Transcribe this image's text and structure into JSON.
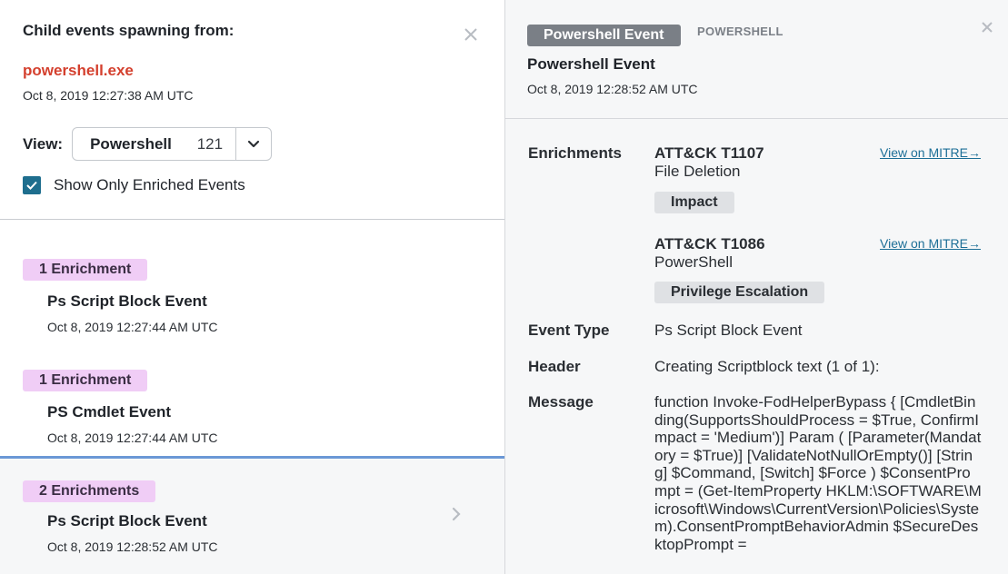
{
  "left_panel": {
    "title": "Child events spawning from:",
    "process": "powershell.exe",
    "timestamp": "Oct 8, 2019 12:27:38 AM UTC",
    "view": {
      "label": "View:",
      "selected": "Powershell",
      "count": "121"
    },
    "checkbox": {
      "label": "Show Only Enriched Events",
      "checked": true
    },
    "events": [
      {
        "badge": "1 Enrichment",
        "name": "Ps Script Block Event",
        "timestamp": "Oct 8, 2019 12:27:44 AM UTC"
      },
      {
        "badge": "1 Enrichment",
        "name": "PS Cmdlet Event",
        "timestamp": "Oct 8, 2019 12:27:44 AM UTC"
      },
      {
        "badge": "2 Enrichments",
        "name": "Ps Script Block Event",
        "timestamp": "Oct 8, 2019 12:28:52 AM UTC"
      }
    ]
  },
  "right_panel": {
    "tag": "Powershell Event",
    "source": "POWERSHELL",
    "title": "Powershell Event",
    "timestamp": "Oct 8, 2019 12:28:52 AM UTC",
    "enrichments_label": "Enrichments",
    "enrichments": [
      {
        "id": "ATT&CK T1107",
        "name": "File Deletion",
        "tactic": "Impact",
        "link": "View on MITRE→"
      },
      {
        "id": "ATT&CK T1086",
        "name": "PowerShell",
        "tactic": "Privilege Escalation",
        "link": "View on MITRE→"
      }
    ],
    "event_type_label": "Event Type",
    "event_type": "Ps Script Block Event",
    "header_label": "Header",
    "header": "Creating Scriptblock text (1 of 1):",
    "message_label": "Message",
    "message": "function Invoke-FodHelperBypass { [CmdletBinding(SupportsShouldProcess = $True, ConfirmImpact = 'Medium')] Param ( [Parameter(Mandatory = $True)] [ValidateNotNullOrEmpty()] [String] $Command, [Switch] $Force ) $ConsentPrompt = (Get-ItemProperty HKLM:\\SOFTWARE\\Microsoft\\Windows\\CurrentVersion\\Policies\\System).ConsentPromptBehaviorAdmin $SecureDesktopPrompt ="
  },
  "icons": [
    "close-icon",
    "chevron-down-icon",
    "checkmark-icon",
    "chevron-right-icon"
  ],
  "colors": {
    "process_red": "#d4402e",
    "checkbox_teal": "#1e6e8e",
    "enrichment_badge": "#f0cdf6",
    "tag_gray": "#7a7f86",
    "link_blue": "#1d6f97",
    "selection_blue": "#6b98d6"
  }
}
